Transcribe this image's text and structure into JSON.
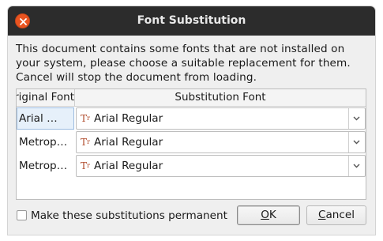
{
  "dialog": {
    "title": "Font Substitution",
    "message": "This document contains some fonts that are not installed on your system, please choose a suitable replacement for them. Cancel will stop the document from loading."
  },
  "table": {
    "headers": {
      "original": "Original Font",
      "substitution": "Substitution Font"
    },
    "rows": [
      {
        "original": "Arial …",
        "substitution": "Arial Regular",
        "selected": true
      },
      {
        "original": "Metrop…",
        "substitution": "Arial Regular",
        "selected": false
      },
      {
        "original": "Metrop…",
        "substitution": "Arial Regular",
        "selected": false
      }
    ]
  },
  "options": {
    "permanent_label": "Make these substitutions permanent",
    "permanent_checked": false
  },
  "buttons": {
    "ok_mnemonic": "O",
    "ok_rest": "K",
    "cancel_mnemonic": "C",
    "cancel_rest": "ancel"
  },
  "icons": {
    "close": "close-icon",
    "font": "font-type-icon",
    "dropdown": "chevron-down-icon"
  },
  "colors": {
    "titlebar": "#2c2c2c",
    "close_button": "#e95420",
    "selection": "#e6f0fa"
  }
}
